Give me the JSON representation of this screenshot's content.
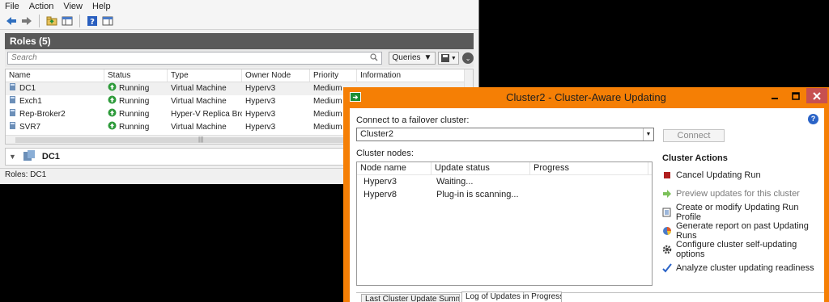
{
  "fcm": {
    "menu": [
      "File",
      "Action",
      "View",
      "Help"
    ],
    "roles_header": "Roles (5)",
    "search_placeholder": "Search",
    "queries_label": "Queries",
    "columns": [
      "Name",
      "Status",
      "Type",
      "Owner Node",
      "Priority",
      "Information"
    ],
    "rows": [
      {
        "name": "DC1",
        "status": "Running",
        "type": "Virtual Machine",
        "owner": "Hyperv3",
        "priority": "Medium",
        "info": ""
      },
      {
        "name": "Exch1",
        "status": "Running",
        "type": "Virtual Machine",
        "owner": "Hyperv3",
        "priority": "Medium",
        "info": ""
      },
      {
        "name": "Rep-Broker2",
        "status": "Running",
        "type": "Hyper-V Replica Brok...",
        "owner": "Hyperv3",
        "priority": "Medium",
        "info": ""
      },
      {
        "name": "SVR7",
        "status": "Running",
        "type": "Virtual Machine",
        "owner": "Hyperv3",
        "priority": "Medium",
        "info": ""
      }
    ],
    "detail_name": "DC1",
    "status_bar": "Roles:  DC1"
  },
  "cau": {
    "title": "Cluster2 - Cluster-Aware Updating",
    "connect_label": "Connect to a failover cluster:",
    "cluster_value": "Cluster2",
    "connect_button": "Connect",
    "nodes_label": "Cluster nodes:",
    "columns": [
      "Node name",
      "Update status",
      "Progress"
    ],
    "nodes": [
      {
        "name": "Hyperv3",
        "status": "Waiting...",
        "progress": ""
      },
      {
        "name": "Hyperv8",
        "status": "Plug-in is scanning...",
        "progress": ""
      }
    ],
    "actions_title": "Cluster Actions",
    "actions": [
      {
        "label": "Cancel Updating Run",
        "icon": "stop-icon",
        "enabled": true
      },
      {
        "label": "Preview updates for this cluster",
        "icon": "arrow-right-icon",
        "enabled": false
      },
      {
        "label": "Create or modify Updating Run Profile",
        "icon": "document-icon",
        "enabled": true
      },
      {
        "label": "Generate report on past Updating Runs",
        "icon": "report-icon",
        "enabled": true
      },
      {
        "label": "Configure cluster self-updating options",
        "icon": "gear-icon",
        "enabled": true
      },
      {
        "label": "Analyze cluster updating readiness",
        "icon": "checkmark-icon",
        "enabled": true
      }
    ],
    "tabs": [
      "Last Cluster Update Summary",
      "Log of Updates in Progress"
    ],
    "colors": {
      "titlebar": "#f57f05",
      "close": "#c75050",
      "stop": "#b01e1e",
      "green": "#7cc15a"
    }
  }
}
